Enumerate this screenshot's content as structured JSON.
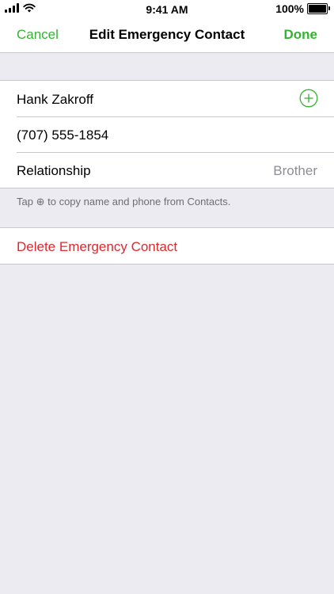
{
  "status_bar": {
    "time": "9:41 AM",
    "battery": "100%",
    "battery_level": 1.0,
    "icons": [
      "signal-icon",
      "wifi-icon",
      "battery-icon"
    ]
  },
  "nav": {
    "cancel": "Cancel",
    "title": "Edit Emergency Contact",
    "done": "Done"
  },
  "contact": {
    "name": "Hank Zakroff",
    "phone": "(707) 555-1854",
    "relationship_label": "Relationship",
    "relationship_value": "Brother",
    "add_icon": "plus-circle-icon"
  },
  "footer": {
    "note_before": "Tap",
    "note_glyph": "⊕",
    "note_after": "to copy name and phone from Contacts."
  },
  "delete": {
    "label": "Delete Emergency Contact"
  },
  "colors": {
    "accent": "#34b233",
    "destructive": "#e0282e",
    "background": "#ebebf1",
    "separator": "#c8c7cc",
    "secondary_text": "#8e8e93"
  }
}
